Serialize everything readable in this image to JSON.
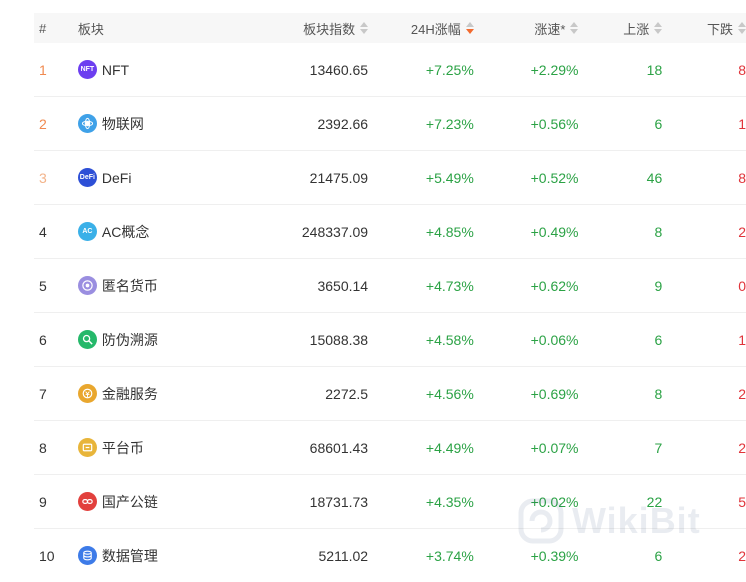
{
  "header": {
    "rank": "#",
    "name": "板块",
    "index": "板块指数",
    "change24h": "24H涨幅",
    "speed": "涨速*",
    "up": "上涨",
    "down": "下跌"
  },
  "rows": [
    {
      "rank": "1",
      "name": "NFT",
      "icon": "nft-icon",
      "iconColor": "#6c3ef0",
      "iconText": "NFT",
      "index": "13460.65",
      "change": "+7.25%",
      "speed": "+2.29%",
      "up": "18",
      "down": "8"
    },
    {
      "rank": "2",
      "name": "物联网",
      "icon": "iot-icon",
      "iconColor": "#3fa1e8",
      "iconText": "",
      "index": "2392.66",
      "change": "+7.23%",
      "speed": "+0.56%",
      "up": "6",
      "down": "1"
    },
    {
      "rank": "3",
      "name": "DeFi",
      "icon": "defi-icon",
      "iconColor": "#2d4fd6",
      "iconText": "DeFi",
      "index": "21475.09",
      "change": "+5.49%",
      "speed": "+0.52%",
      "up": "46",
      "down": "8"
    },
    {
      "rank": "4",
      "name": "AC概念",
      "icon": "ac-icon",
      "iconColor": "#3ab0e8",
      "iconText": "AC",
      "index": "248337.09",
      "change": "+4.85%",
      "speed": "+0.49%",
      "up": "8",
      "down": "2"
    },
    {
      "rank": "5",
      "name": "匿名货币",
      "icon": "anonymous-coin-icon",
      "iconColor": "#9a8ee0",
      "iconText": "",
      "index": "3650.14",
      "change": "+4.73%",
      "speed": "+0.62%",
      "up": "9",
      "down": "0"
    },
    {
      "rank": "6",
      "name": "防伪溯源",
      "icon": "anti-counterfeit-icon",
      "iconColor": "#25b86a",
      "iconText": "",
      "index": "15088.38",
      "change": "+4.58%",
      "speed": "+0.06%",
      "up": "6",
      "down": "1"
    },
    {
      "rank": "7",
      "name": "金融服务",
      "icon": "finance-icon",
      "iconColor": "#e9a72e",
      "iconText": "",
      "index": "2272.5",
      "change": "+4.56%",
      "speed": "+0.69%",
      "up": "8",
      "down": "2"
    },
    {
      "rank": "8",
      "name": "平台币",
      "icon": "platform-coin-icon",
      "iconColor": "#e8b53a",
      "iconText": "",
      "index": "68601.43",
      "change": "+4.49%",
      "speed": "+0.07%",
      "up": "7",
      "down": "2"
    },
    {
      "rank": "9",
      "name": "国产公链",
      "icon": "public-chain-icon",
      "iconColor": "#e2403d",
      "iconText": "",
      "index": "18731.73",
      "change": "+4.35%",
      "speed": "+0.02%",
      "up": "22",
      "down": "5"
    },
    {
      "rank": "10",
      "name": "数据管理",
      "icon": "data-management-icon",
      "iconColor": "#3d7be8",
      "iconText": "",
      "index": "5211.02",
      "change": "+3.74%",
      "speed": "+0.39%",
      "up": "6",
      "down": "2"
    }
  ],
  "watermark": {
    "text": "WikiBit"
  },
  "colors": {
    "positive": "#2ba245",
    "negative": "#e0343a",
    "sortActive": "#f26a2e"
  }
}
